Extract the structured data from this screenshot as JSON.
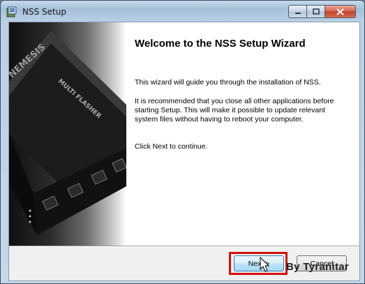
{
  "window": {
    "title": "NSS Setup",
    "app_icon": "installer-icon",
    "controls": {
      "minimize": "minimize-icon",
      "maximize": "maximize-icon",
      "close": "close-icon"
    }
  },
  "left_panel": {
    "image": "device-photo",
    "device_text_1": "NEMESIS",
    "device_text_2": "MULTI FLASHER"
  },
  "content": {
    "heading": "Welcome to the NSS Setup Wizard",
    "paragraph_1": "This wizard will guide you through the installation of NSS.",
    "paragraph_2": "It is recommended that you close all other applications before starting Setup. This will make it possible to update relevant system files without having to reboot your computer.",
    "paragraph_3": "Click Next to continue."
  },
  "buttons": {
    "next": "Next >",
    "cancel": "Cancel"
  },
  "annotation": {
    "watermark": "By Tyranitar",
    "highlight_color": "#d01010"
  }
}
